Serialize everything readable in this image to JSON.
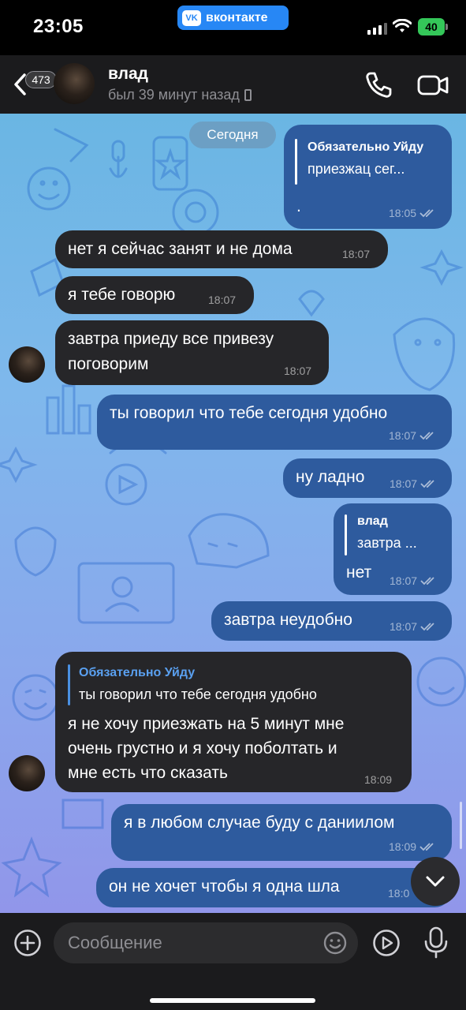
{
  "status_bar": {
    "time": "23:05",
    "app_pill_label": "вконтакте",
    "app_pill_logo": "VK",
    "battery_level": "40",
    "accent_color": "#2787f5",
    "battery_color": "#34c759"
  },
  "header": {
    "unread_count": "473",
    "contact_name": "влад",
    "last_seen": "был 39 минут назад",
    "icons": [
      "back-chevron-icon",
      "phone-icon",
      "video-camera-icon",
      "mobile-device-icon"
    ]
  },
  "chat": {
    "date_chip": "Сегодня",
    "messages": [
      {
        "dir": "out",
        "reply_name": "Обязательно Уйду",
        "reply_text": "приезжац сег...",
        "text": ".",
        "time": "18:05",
        "read": true
      },
      {
        "dir": "in",
        "text": "нет я сейчас занят и не дома",
        "time": "18:07"
      },
      {
        "dir": "in",
        "text": "я тебе говорю",
        "time": "18:07"
      },
      {
        "dir": "in",
        "lines": [
          "завтра приеду все привезу",
          "поговорим"
        ],
        "time": "18:07"
      },
      {
        "dir": "out",
        "text": "ты говорил что тебе сегодня удобно",
        "time": "18:07",
        "read": true
      },
      {
        "dir": "out",
        "text": "ну ладно",
        "time": "18:07",
        "read": true
      },
      {
        "dir": "out",
        "reply_name": "влад",
        "reply_text": "завтра ...",
        "text": "нет",
        "time": "18:07",
        "read": true
      },
      {
        "dir": "out",
        "text": "завтра неудобно",
        "time": "18:07",
        "read": true
      },
      {
        "dir": "in",
        "reply_name": "Обязательно Уйду",
        "reply_text": "ты говорил что тебе сегодня удобно",
        "lines": [
          "я не хочу приезжать на 5 минут мне",
          "очень грустно и я хочу поболтать и",
          "мне есть что сказать"
        ],
        "time": "18:09"
      },
      {
        "dir": "out",
        "text": "я в любом случае буду с даниилом",
        "time": "18:09",
        "read": true
      },
      {
        "dir": "out",
        "text": "он не хочет чтобы я одна шла",
        "time": "18:0",
        "read": true
      }
    ],
    "colors": {
      "incoming_bubble": "#262629",
      "outgoing_bubble": "#2e5b9e",
      "reply_accent": "#4a90e2"
    }
  },
  "composer": {
    "placeholder": "Сообщение",
    "icons": [
      "plus-icon",
      "emoji-icon",
      "stickers-icon",
      "microphone-icon",
      "chevron-down-icon"
    ]
  }
}
